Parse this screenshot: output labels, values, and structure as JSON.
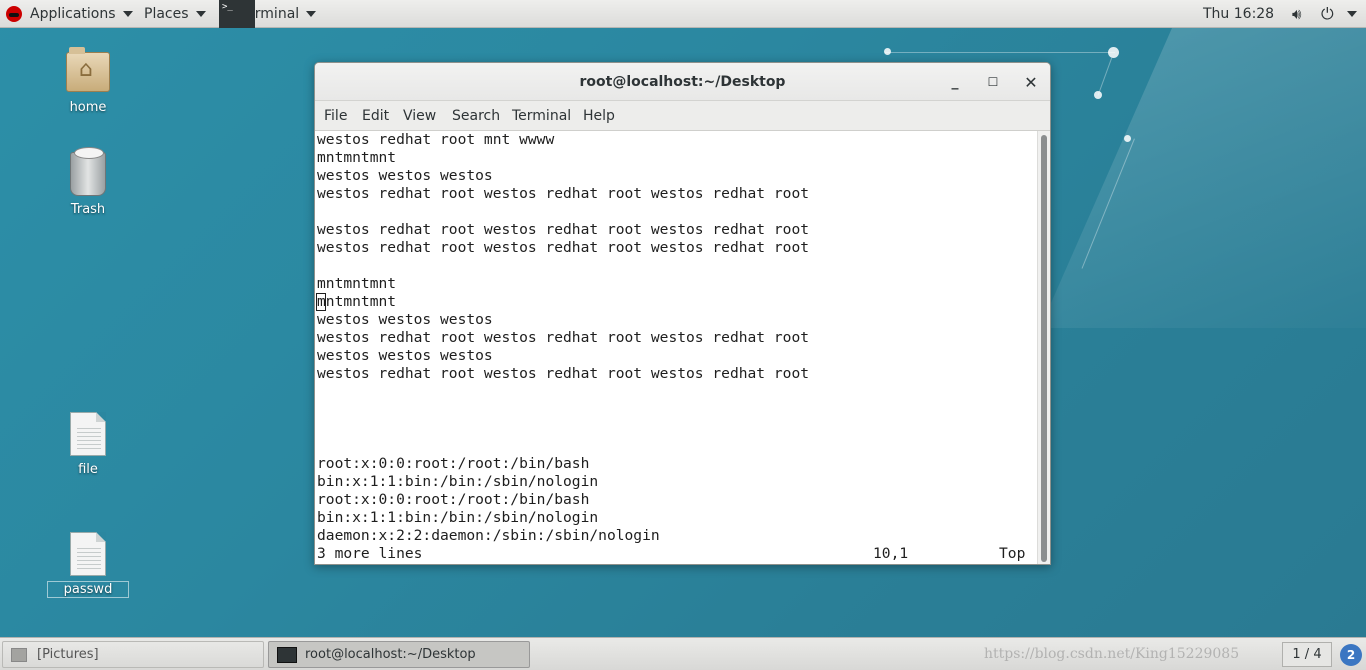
{
  "topbar": {
    "applications_label": "Applications",
    "places_label": "Places",
    "terminal_label": "Terminal",
    "clock": "Thu 16:28"
  },
  "desktop": {
    "icons": [
      {
        "label": "home",
        "icon": "home-folder-icon"
      },
      {
        "label": "Trash",
        "icon": "trash-icon"
      },
      {
        "label": "file",
        "icon": "document-icon"
      },
      {
        "label": "passwd",
        "icon": "document-icon"
      }
    ]
  },
  "window": {
    "title": "root@localhost:~/Desktop",
    "menu": [
      "File",
      "Edit",
      "View",
      "Search",
      "Terminal",
      "Help"
    ],
    "lines": [
      "westos redhat root mnt wwww",
      "mntmntmnt",
      "westos westos westos",
      "westos redhat root westos redhat root westos redhat root",
      "",
      "westos redhat root westos redhat root westos redhat root",
      "westos redhat root westos redhat root westos redhat root",
      "",
      "mntmntmnt",
      "mntmntmnt",
      "westos westos westos",
      "westos redhat root westos redhat root westos redhat root",
      "westos westos westos",
      "westos redhat root westos redhat root westos redhat root",
      "",
      "",
      "",
      "",
      "root:x:0:0:root:/root:/bin/bash",
      "bin:x:1:1:bin:/bin:/sbin/nologin",
      "root:x:0:0:root:/root:/bin/bash",
      "bin:x:1:1:bin:/bin:/sbin/nologin",
      "daemon:x:2:2:daemon:/sbin:/sbin/nologin"
    ],
    "status": {
      "message": "3 more lines",
      "position": "10,1",
      "scroll": "Top"
    }
  },
  "taskbar": {
    "items": [
      "[Pictures]",
      "root@localhost:~/Desktop"
    ],
    "workspace": "1 / 4",
    "notifications": "2",
    "watermark": "https://blog.csdn.net/King15229085"
  }
}
